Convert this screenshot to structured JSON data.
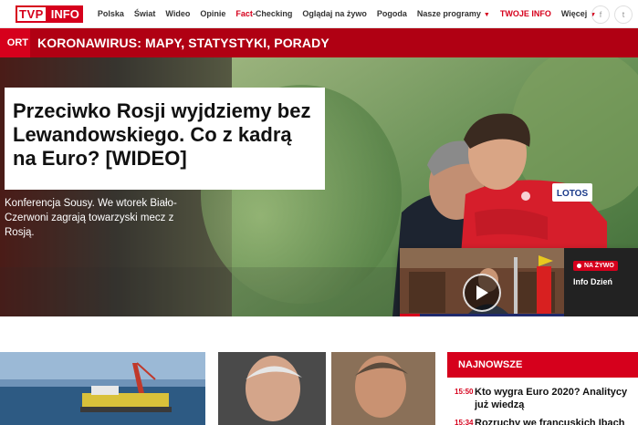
{
  "logo": {
    "part1": "TVP",
    "part2": "INFO"
  },
  "nav": {
    "links": [
      "Polska",
      "Świat",
      "Wideo",
      "Opinie"
    ],
    "fact_prefix": "Fact",
    "fact_suffix": "-Checking",
    "links2": [
      "Oglądaj na żywo",
      "Pogoda"
    ],
    "programs": "Nasze programy",
    "twoje_info": "TWOJE INFO",
    "wiecej": "Więcej",
    "social": [
      "f",
      "t"
    ]
  },
  "topic_bar": {
    "tag": "ORT",
    "title": "KORONAWIRUS: MAPY, STATYSTYKI, PORADY"
  },
  "hero": {
    "headline": "Przeciwko Rosji wyjdziemy bez Lewandowskiego. Co z kadrą na Euro? [WIDEO]",
    "lead": "Konferencja Sousy. We wtorek Biało-Czerwoni zagrają towarzyski mecz z Rosją.",
    "sponsor": "LOTOS"
  },
  "live": {
    "badge": "NA ŻYWO",
    "program": "Info Dzień"
  },
  "najnowsze": {
    "heading": "NAJNOWSZE",
    "items": [
      {
        "time": "15:50",
        "text": "Kto wygra Euro 2020? Analitycy już wiedzą"
      },
      {
        "time": "15:34",
        "text": "Rozruchy we francuskich Ibach w"
      }
    ]
  },
  "colors": {
    "brand_red": "#d6001c",
    "dark_red": "#b00013"
  }
}
